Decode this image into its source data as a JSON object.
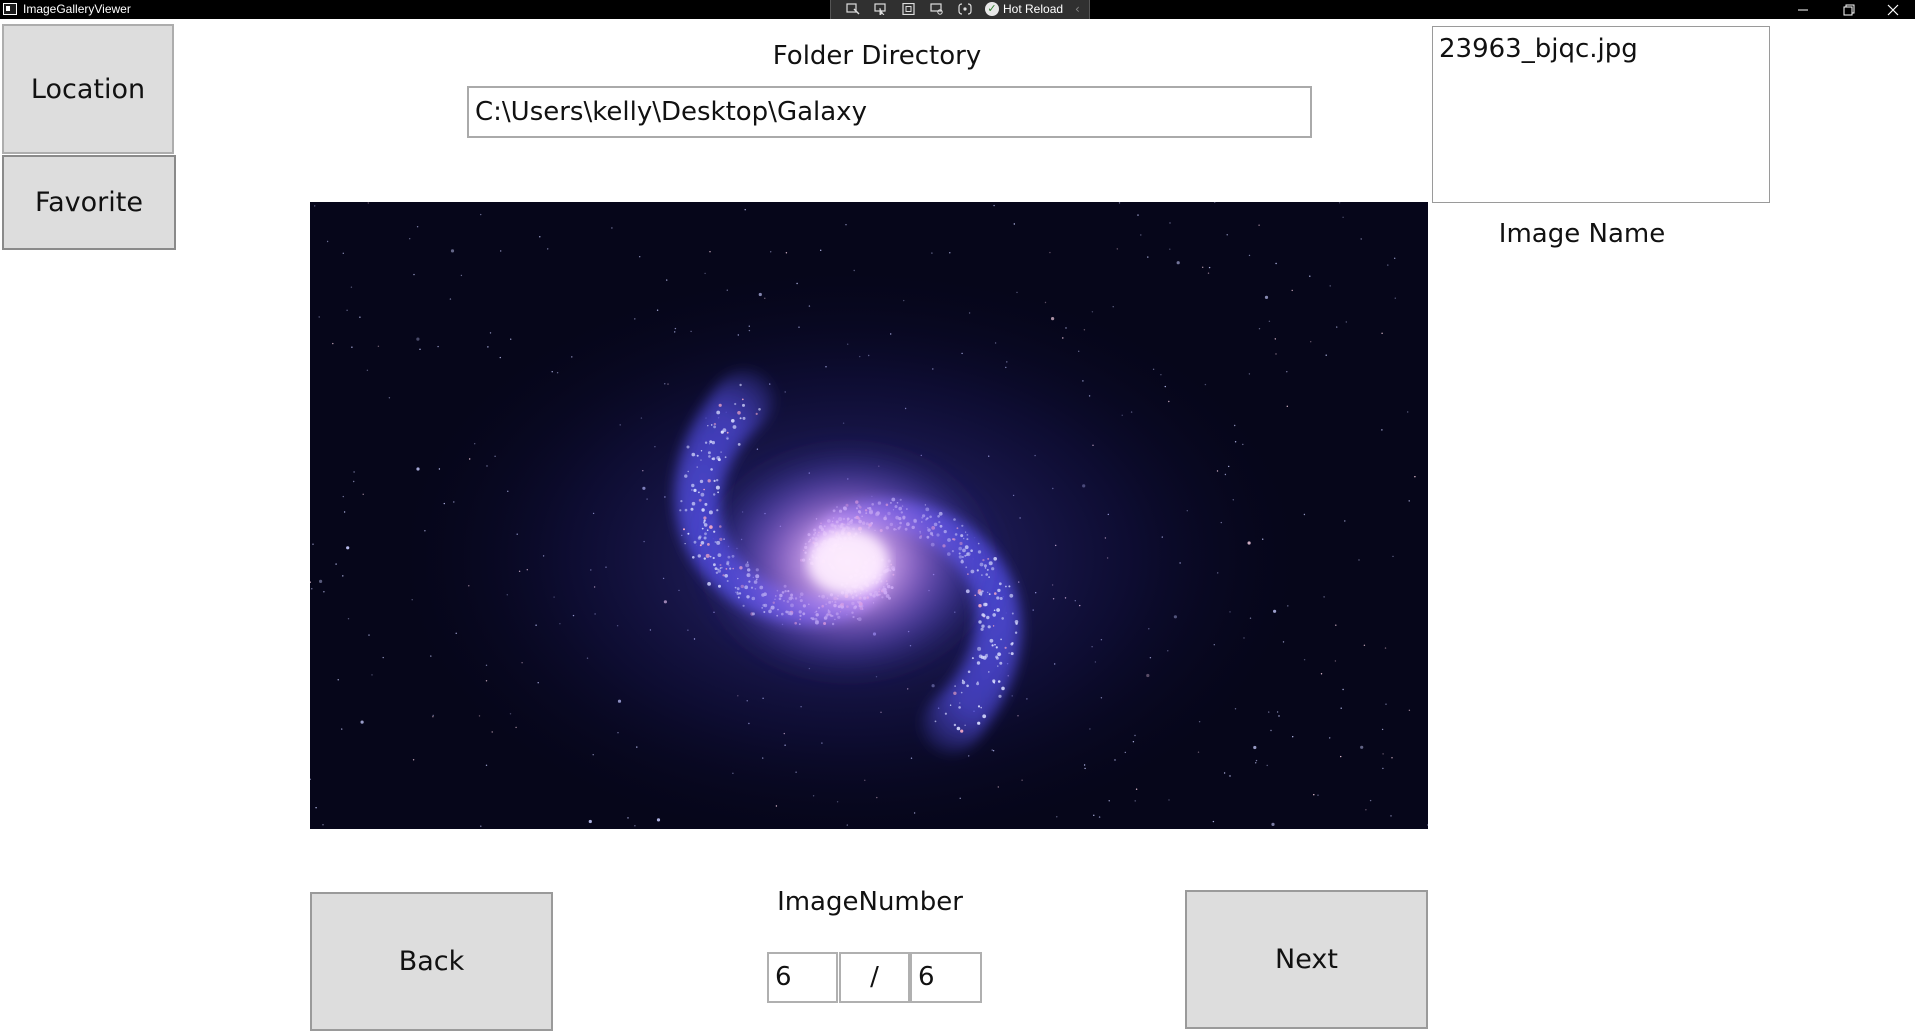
{
  "window": {
    "title": "ImageGalleryViewer",
    "hot_reload_label": "Hot Reload",
    "debug_icons": [
      "live-visual-tree-icon",
      "select-element-icon",
      "display-layout-adorners-icon",
      "track-focus-icon",
      "toggle-xaml-binding-icon"
    ],
    "controls": [
      "minimize-icon",
      "restore-icon",
      "close-icon"
    ]
  },
  "sidebar": {
    "location_label": "Location",
    "favorite_label": "Favorite"
  },
  "folder": {
    "label": "Folder Directory",
    "path": "C:\\Users\\kelly\\Desktop\\Galaxy"
  },
  "image_info": {
    "file_name": "23963_bjqc.jpg",
    "name_label": "Image Name"
  },
  "navigation": {
    "back_label": "Back",
    "next_label": "Next",
    "number_label": "ImageNumber",
    "current": "6",
    "separator": "/",
    "total": "6"
  },
  "colors": {
    "button_bg": "#dddddd",
    "titlebar_bg": "#000000",
    "galaxy_core": "#f4c8ff",
    "galaxy_arm": "#5a4fd8"
  }
}
